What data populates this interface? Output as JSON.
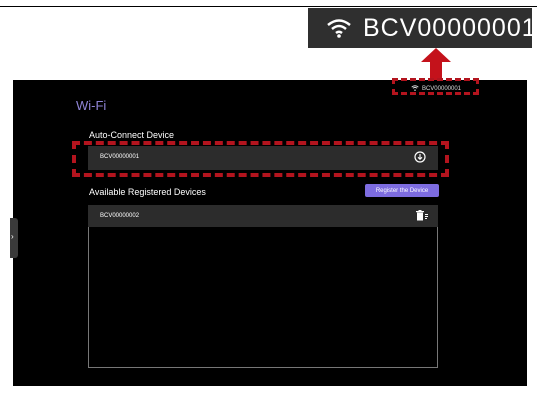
{
  "callout": {
    "ssid": "BCV00000001",
    "wifi_icon": "wifi-icon"
  },
  "status": {
    "ssid_mini": "BCV00000001"
  },
  "page": {
    "title": "Wi-Fi"
  },
  "auto_connect": {
    "label": "Auto-Connect Device",
    "device": "BCV00000001",
    "action_icon": "download-icon"
  },
  "available": {
    "label": "Available Registered Devices",
    "register_button": "Register the Device",
    "devices": [
      {
        "name": "BCV00000002",
        "action_icon": "delete-icon"
      }
    ]
  },
  "colors": {
    "accent": "#7d6ce0",
    "highlight": "#b3141e",
    "title": "#8f84d6"
  }
}
